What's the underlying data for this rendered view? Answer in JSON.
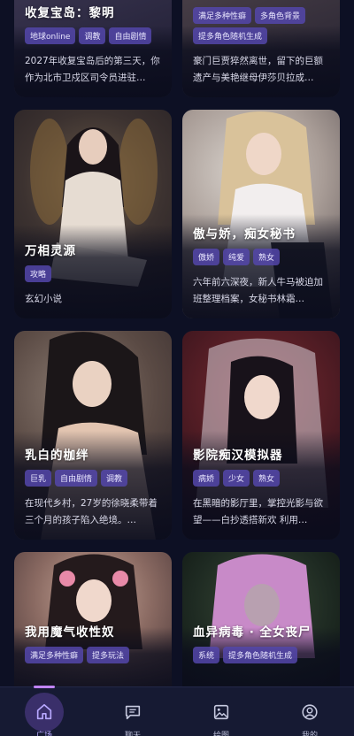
{
  "cards": [
    {
      "title": "收复宝岛：黎明",
      "tags": [
        "地球online",
        "调教",
        "自由剧情"
      ],
      "desc": "2027年收复宝岛后的第三天，你作为北市卫戍区司令员进驻…"
    },
    {
      "title": "",
      "tags": [
        "满足多种性癖",
        "多角色背景",
        "提多角色随机生成"
      ],
      "desc": "豪门巨贾猝然离世，留下的巨额遗产与美艳继母伊莎贝拉成…"
    },
    {
      "title": "万相灵源",
      "tags": [
        "攻略"
      ],
      "desc": "玄幻小说"
    },
    {
      "title": "傲与娇，痴女秘书",
      "tags": [
        "傲娇",
        "纯爱",
        "熟女"
      ],
      "desc": "六年前六深夜，新人牛马被迫加班整理档案，女秘书林霜…"
    },
    {
      "title": "乳白的枷绊",
      "tags": [
        "巨乳",
        "自由剧情",
        "调教"
      ],
      "desc": "在现代乡村，27岁的徐晓柔带着三个月的孩子陷入绝境。…"
    },
    {
      "title": "影院痴汉模拟器",
      "tags": [
        "病娇",
        "少女",
        "熟女"
      ],
      "desc": "在黑暗的影厅里，掌控光影与欲望——白抄透搭新欢 利用…"
    },
    {
      "title": "我用魔气收性奴",
      "tags": [
        "满足多种性癖",
        "提多玩法"
      ],
      "desc": ""
    },
    {
      "title": "血异病毒 · 全女丧尸",
      "tags": [
        "系统",
        "提多角色随机生成"
      ],
      "desc": ""
    }
  ],
  "nav": [
    {
      "label": "广场",
      "icon": "home-icon",
      "active": true
    },
    {
      "label": "聊天",
      "icon": "chat-icon",
      "active": false
    },
    {
      "label": "绘图",
      "icon": "image-icon",
      "active": false
    },
    {
      "label": "我的",
      "icon": "profile-icon",
      "active": false
    }
  ],
  "colors": {
    "background": "#0d1024",
    "tag": "#5446aa",
    "accent": "#c084fc",
    "nav_bg": "#161a33"
  }
}
